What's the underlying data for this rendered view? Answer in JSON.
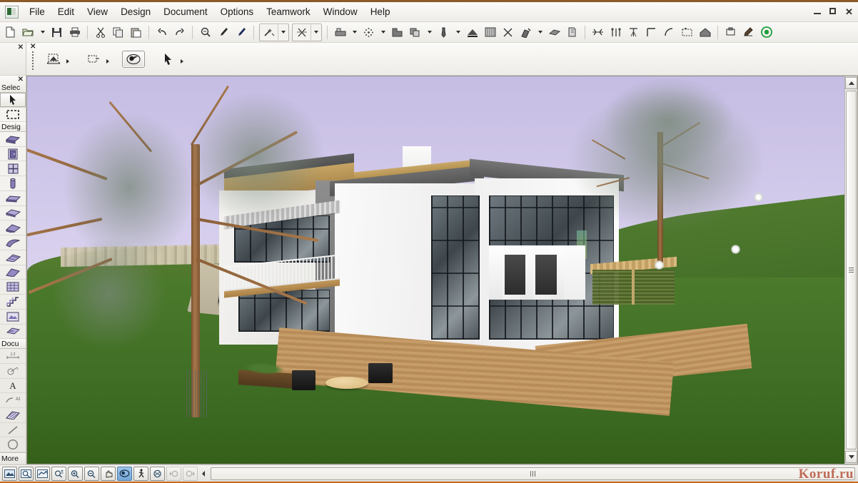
{
  "window": {
    "app_icon": "archicad-app-icon",
    "controls": {
      "minimize": "–",
      "maximize": "❐",
      "close": "✕"
    }
  },
  "menubar": {
    "items": [
      {
        "label": "File"
      },
      {
        "label": "Edit"
      },
      {
        "label": "View"
      },
      {
        "label": "Design"
      },
      {
        "label": "Document"
      },
      {
        "label": "Options"
      },
      {
        "label": "Teamwork"
      },
      {
        "label": "Window"
      },
      {
        "label": "Help"
      }
    ]
  },
  "toolbar": {
    "groups": [
      {
        "buttons": [
          {
            "icon": "new-document-icon"
          },
          {
            "icon": "open-folder-icon",
            "dropdown": true
          },
          {
            "icon": "save-disk-icon"
          },
          {
            "icon": "print-icon"
          }
        ]
      },
      {
        "buttons": [
          {
            "icon": "cut-scissors-icon"
          },
          {
            "icon": "copy-icon"
          },
          {
            "icon": "paste-icon"
          }
        ]
      },
      {
        "buttons": [
          {
            "icon": "undo-arrow-icon"
          },
          {
            "icon": "redo-arrow-icon"
          }
        ]
      },
      {
        "buttons": [
          {
            "icon": "find-select-icon"
          },
          {
            "icon": "pick-up-parameters-icon"
          },
          {
            "icon": "inject-parameters-icon"
          }
        ]
      },
      {
        "framed": true,
        "buttons": [
          {
            "icon": "magic-wand-icon",
            "dropdown": true
          }
        ]
      },
      {
        "framed": true,
        "buttons": [
          {
            "icon": "trim-scissors-icon",
            "dropdown": true
          }
        ]
      },
      {
        "buttons": [
          {
            "icon": "storey-settings-icon",
            "dropdown": true
          },
          {
            "icon": "grid-snap-icon",
            "dropdown": true
          },
          {
            "icon": "layer-settings-icon"
          },
          {
            "icon": "display-order-icon",
            "dropdown": true
          },
          {
            "icon": "pen-set-icon",
            "dropdown": true
          },
          {
            "icon": "render-setting-icon"
          },
          {
            "icon": "surface-catalog-icon"
          },
          {
            "icon": "intersection-icon"
          },
          {
            "icon": "measure-tape-icon",
            "dropdown": true
          },
          {
            "icon": "section-plane-icon"
          },
          {
            "icon": "elevation-icon"
          }
        ]
      },
      {
        "buttons": [
          {
            "icon": "align-icon"
          },
          {
            "icon": "distribute-icon"
          },
          {
            "icon": "column-array-icon"
          },
          {
            "icon": "corner-icon"
          },
          {
            "icon": "arc-icon"
          },
          {
            "icon": "drawing-frame-icon"
          },
          {
            "icon": "home-3d-icon"
          }
        ]
      },
      {
        "buttons": [
          {
            "icon": "object-settings-icon"
          },
          {
            "icon": "light-icon"
          },
          {
            "icon": "photorender-icon",
            "accent": "#1f9d3a"
          }
        ]
      }
    ]
  },
  "palettes": {
    "toolbox_stub": {
      "label": "Selec",
      "close": "✕"
    },
    "navigation_palette": {
      "close": "✕",
      "tools": [
        {
          "name": "marquee-3d-tool",
          "active": false,
          "flyout": true
        },
        {
          "name": "selection-box-tool",
          "active": false,
          "flyout": true
        },
        {
          "name": "orbit-tool",
          "active": true,
          "flyout": false
        },
        {
          "name": "arrow-pointer-tool",
          "active": false,
          "flyout": true
        }
      ]
    }
  },
  "toolbox": {
    "close": "✕",
    "sections": [
      {
        "title": "Selec",
        "items": [
          {
            "name": "arrow-tool",
            "selected": true
          },
          {
            "name": "marquee-tool",
            "selected": false
          }
        ]
      },
      {
        "title": "Desig",
        "items": [
          {
            "name": "wall-tool"
          },
          {
            "name": "door-tool"
          },
          {
            "name": "window-tool"
          },
          {
            "name": "column-tool"
          },
          {
            "name": "beam-tool"
          },
          {
            "name": "slab-tool"
          },
          {
            "name": "roof-tool"
          },
          {
            "name": "shell-tool"
          },
          {
            "name": "mesh-tool"
          },
          {
            "name": "morph-tool"
          },
          {
            "name": "curtain-wall-tool"
          },
          {
            "name": "stair-tool"
          },
          {
            "name": "object-tool"
          },
          {
            "name": "zone-tool"
          }
        ]
      },
      {
        "title": "Docu",
        "items": [
          {
            "name": "dimension-tool"
          },
          {
            "name": "radial-dimension-tool"
          },
          {
            "name": "text-tool"
          },
          {
            "name": "label-tool"
          },
          {
            "name": "fill-tool"
          },
          {
            "name": "line-tool"
          },
          {
            "name": "circle-tool"
          }
        ]
      }
    ],
    "more_label": "More"
  },
  "viewport": {
    "name": "3d-perspective-view",
    "scene": {
      "description": "3D rendered perspective of a modern two-storey house",
      "sky_color": "#cdc5e8",
      "lawn_color": "#44722a",
      "house_wall_color": "#f7f6f4",
      "roof_color": "#5e5e5e",
      "deck_color": "#bf9260",
      "glass_color": "#444c51",
      "wood_trim_color": "#b8914f",
      "elements": [
        "foreground-bare-tree",
        "background-tree",
        "black-car",
        "stone-driveway",
        "stone-wall",
        "green-lawn",
        "green-hill",
        "white-house-volume",
        "glass-curtain-wall",
        "balcony-with-railing",
        "pergola-canopy",
        "wooden-deck",
        "patio-table-and-chairs",
        "planter-box",
        "slatted-screen",
        "carport"
      ]
    },
    "scrollbars": {
      "vertical": {
        "up": "▲",
        "down": "▼"
      },
      "horizontal": {
        "left": "◀",
        "right": "▶"
      }
    }
  },
  "statusbar": {
    "nav_buttons": [
      {
        "name": "fit-in-window-button",
        "active": false,
        "dim": false
      },
      {
        "name": "zoom-area-button",
        "active": false,
        "dim": false
      },
      {
        "name": "previous-zoom-button",
        "active": false,
        "dim": false
      },
      {
        "name": "zoom-plusminus-button",
        "active": false,
        "dim": false
      },
      {
        "name": "zoom-in-button",
        "active": false,
        "dim": false
      },
      {
        "name": "zoom-out-button",
        "active": false,
        "dim": false
      },
      {
        "name": "pan-hand-button",
        "active": false,
        "dim": false
      },
      {
        "name": "orbit-button",
        "active": true,
        "dim": false
      },
      {
        "name": "walk-button",
        "active": false,
        "dim": false
      },
      {
        "name": "explore-button",
        "active": false,
        "dim": false
      },
      {
        "name": "zoom-previous-step-button",
        "active": false,
        "dim": true
      },
      {
        "name": "zoom-next-step-button",
        "active": false,
        "dim": true
      }
    ]
  },
  "watermark": {
    "text": "Koruf.ru"
  }
}
